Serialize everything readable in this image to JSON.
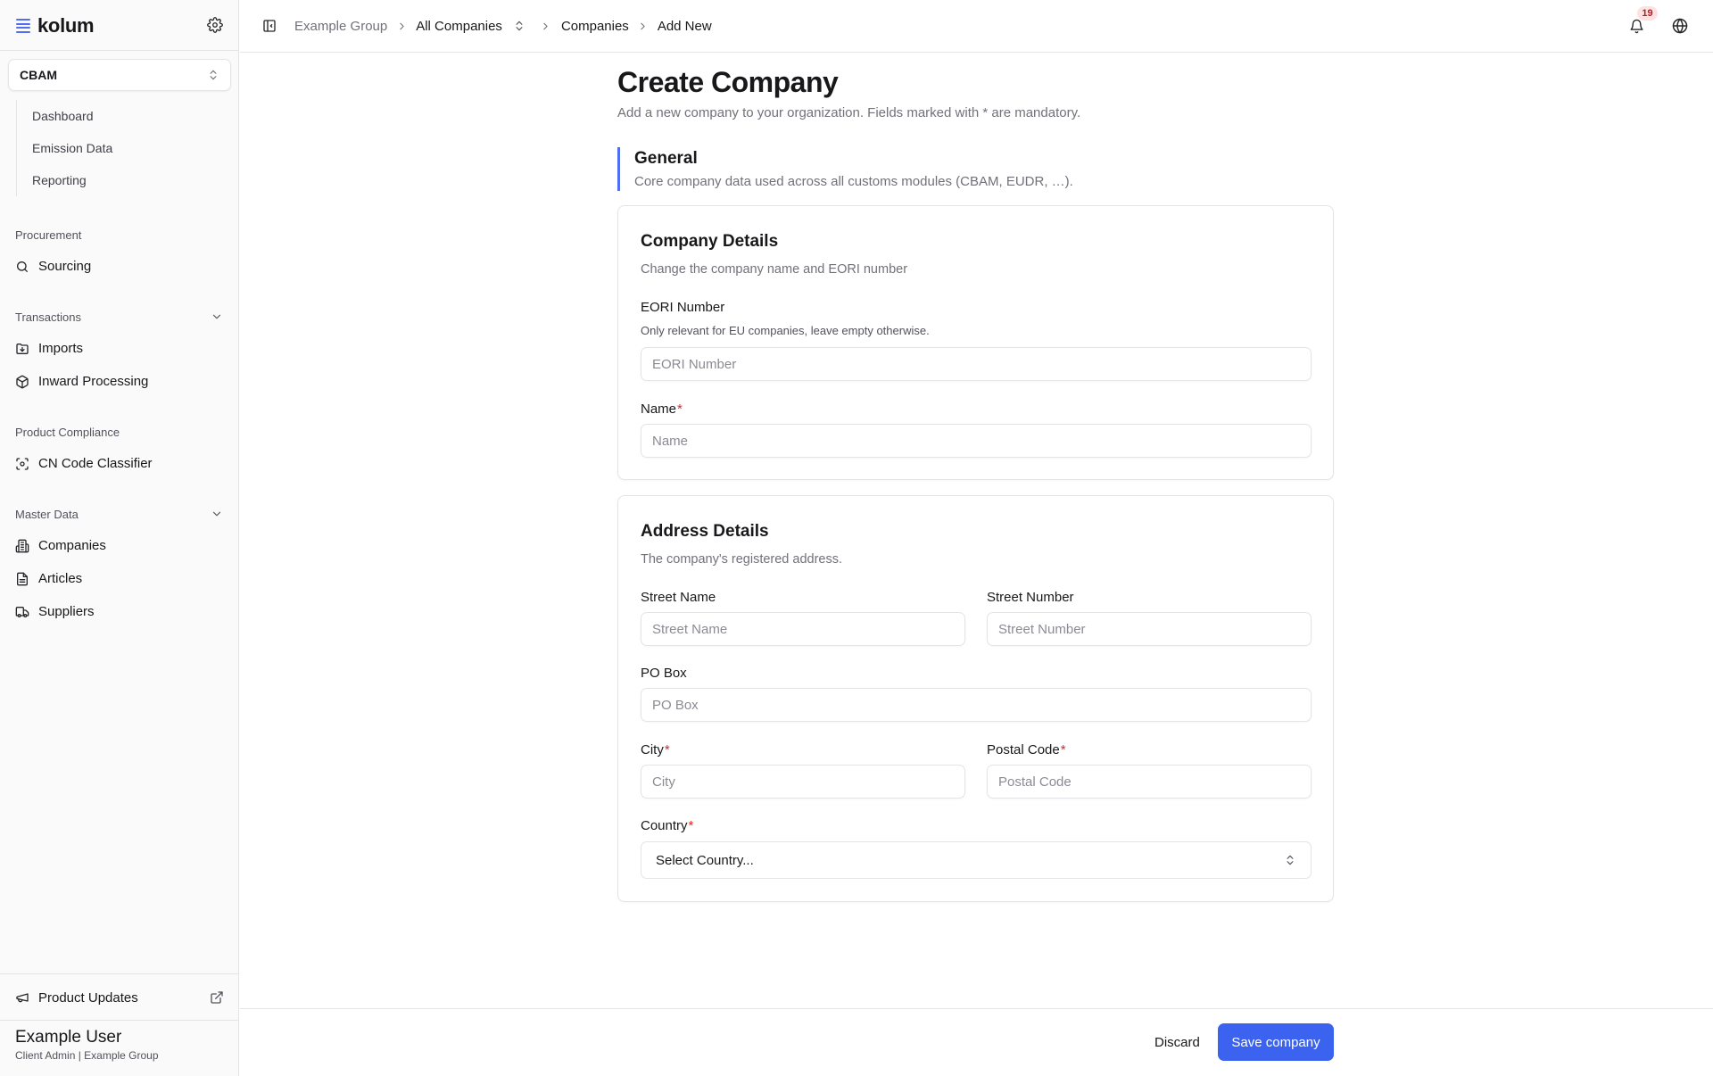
{
  "brand": {
    "name": "kolum"
  },
  "workspace": {
    "selected": "CBAM"
  },
  "sub_nav": [
    {
      "label": "Dashboard"
    },
    {
      "label": "Emission Data"
    },
    {
      "label": "Reporting"
    }
  ],
  "groups": {
    "procurement": {
      "title": "Procurement",
      "items": [
        {
          "label": "Sourcing",
          "icon": "search-icon"
        }
      ]
    },
    "transactions": {
      "title": "Transactions",
      "items": [
        {
          "label": "Imports",
          "icon": "folder-import-icon"
        },
        {
          "label": "Inward Processing",
          "icon": "box-icon"
        }
      ]
    },
    "product_compliance": {
      "title": "Product Compliance",
      "items": [
        {
          "label": "CN Code Classifier",
          "icon": "scan-icon"
        }
      ]
    },
    "master_data": {
      "title": "Master Data",
      "items": [
        {
          "label": "Companies",
          "icon": "building-icon"
        },
        {
          "label": "Articles",
          "icon": "file-icon"
        },
        {
          "label": "Suppliers",
          "icon": "truck-icon"
        }
      ]
    }
  },
  "sidebar_footer": {
    "product_updates": "Product Updates"
  },
  "user": {
    "name": "Example User",
    "role": "Client Admin | Example Group"
  },
  "breadcrumb": {
    "group": "Example Group",
    "companies_switcher": "All Companies",
    "section": "Companies",
    "current": "Add New"
  },
  "notifications": {
    "count": "19"
  },
  "page": {
    "title": "Create Company",
    "subtitle": "Add a new company to your organization. Fields marked with * are mandatory."
  },
  "general": {
    "title": "General",
    "description": "Core company data used across all customs modules (CBAM, EUDR, …)."
  },
  "company_details": {
    "title": "Company Details",
    "description": "Change the company name and EORI number",
    "eori_label": "EORI Number",
    "eori_help": "Only relevant for EU companies, leave empty otherwise.",
    "eori_placeholder": "EORI Number",
    "eori_value": "",
    "name_label": "Name",
    "name_placeholder": "Name",
    "name_value": ""
  },
  "address_details": {
    "title": "Address Details",
    "description": "The company's registered address.",
    "street_name_label": "Street Name",
    "street_name_placeholder": "Street Name",
    "street_number_label": "Street Number",
    "street_number_placeholder": "Street Number",
    "po_box_label": "PO Box",
    "po_box_placeholder": "PO Box",
    "city_label": "City",
    "city_placeholder": "City",
    "postal_code_label": "Postal Code",
    "postal_code_placeholder": "Postal Code",
    "country_label": "Country",
    "country_value": "Select Country..."
  },
  "actions": {
    "discard": "Discard",
    "save": "Save company"
  },
  "colors": {
    "accent": "#3b63f0",
    "required": "#dc2626",
    "badge_bg": "#fee2e2",
    "badge_text": "#b91c1c"
  }
}
